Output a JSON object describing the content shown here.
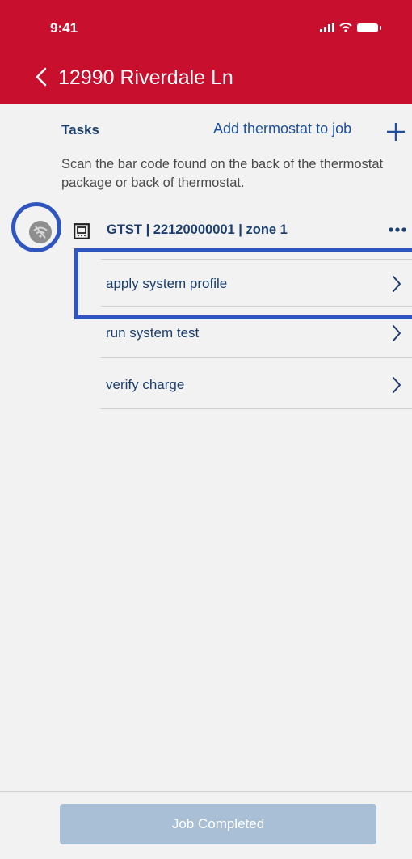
{
  "status_bar": {
    "time": "9:41"
  },
  "header": {
    "title": "12990 Riverdale Ln"
  },
  "tasks": {
    "section_label": "Tasks",
    "add_label": "Add thermostat to job",
    "help_text": "Scan the bar code found on the back of the thermostat package or back of thermostat."
  },
  "device": {
    "label": "GTST | 22120000001 | zone 1"
  },
  "task_rows": [
    {
      "label": "apply system profile"
    },
    {
      "label": "run  system test"
    },
    {
      "label": "verify charge"
    }
  ],
  "footer": {
    "button_label": "Job Completed"
  },
  "colors": {
    "header_bg": "#c8102e",
    "label_blue": "#1b3e6e",
    "link_blue": "#1e4f9c",
    "highlight": "#2f56c0",
    "button_disabled": "#a9bfd6"
  }
}
